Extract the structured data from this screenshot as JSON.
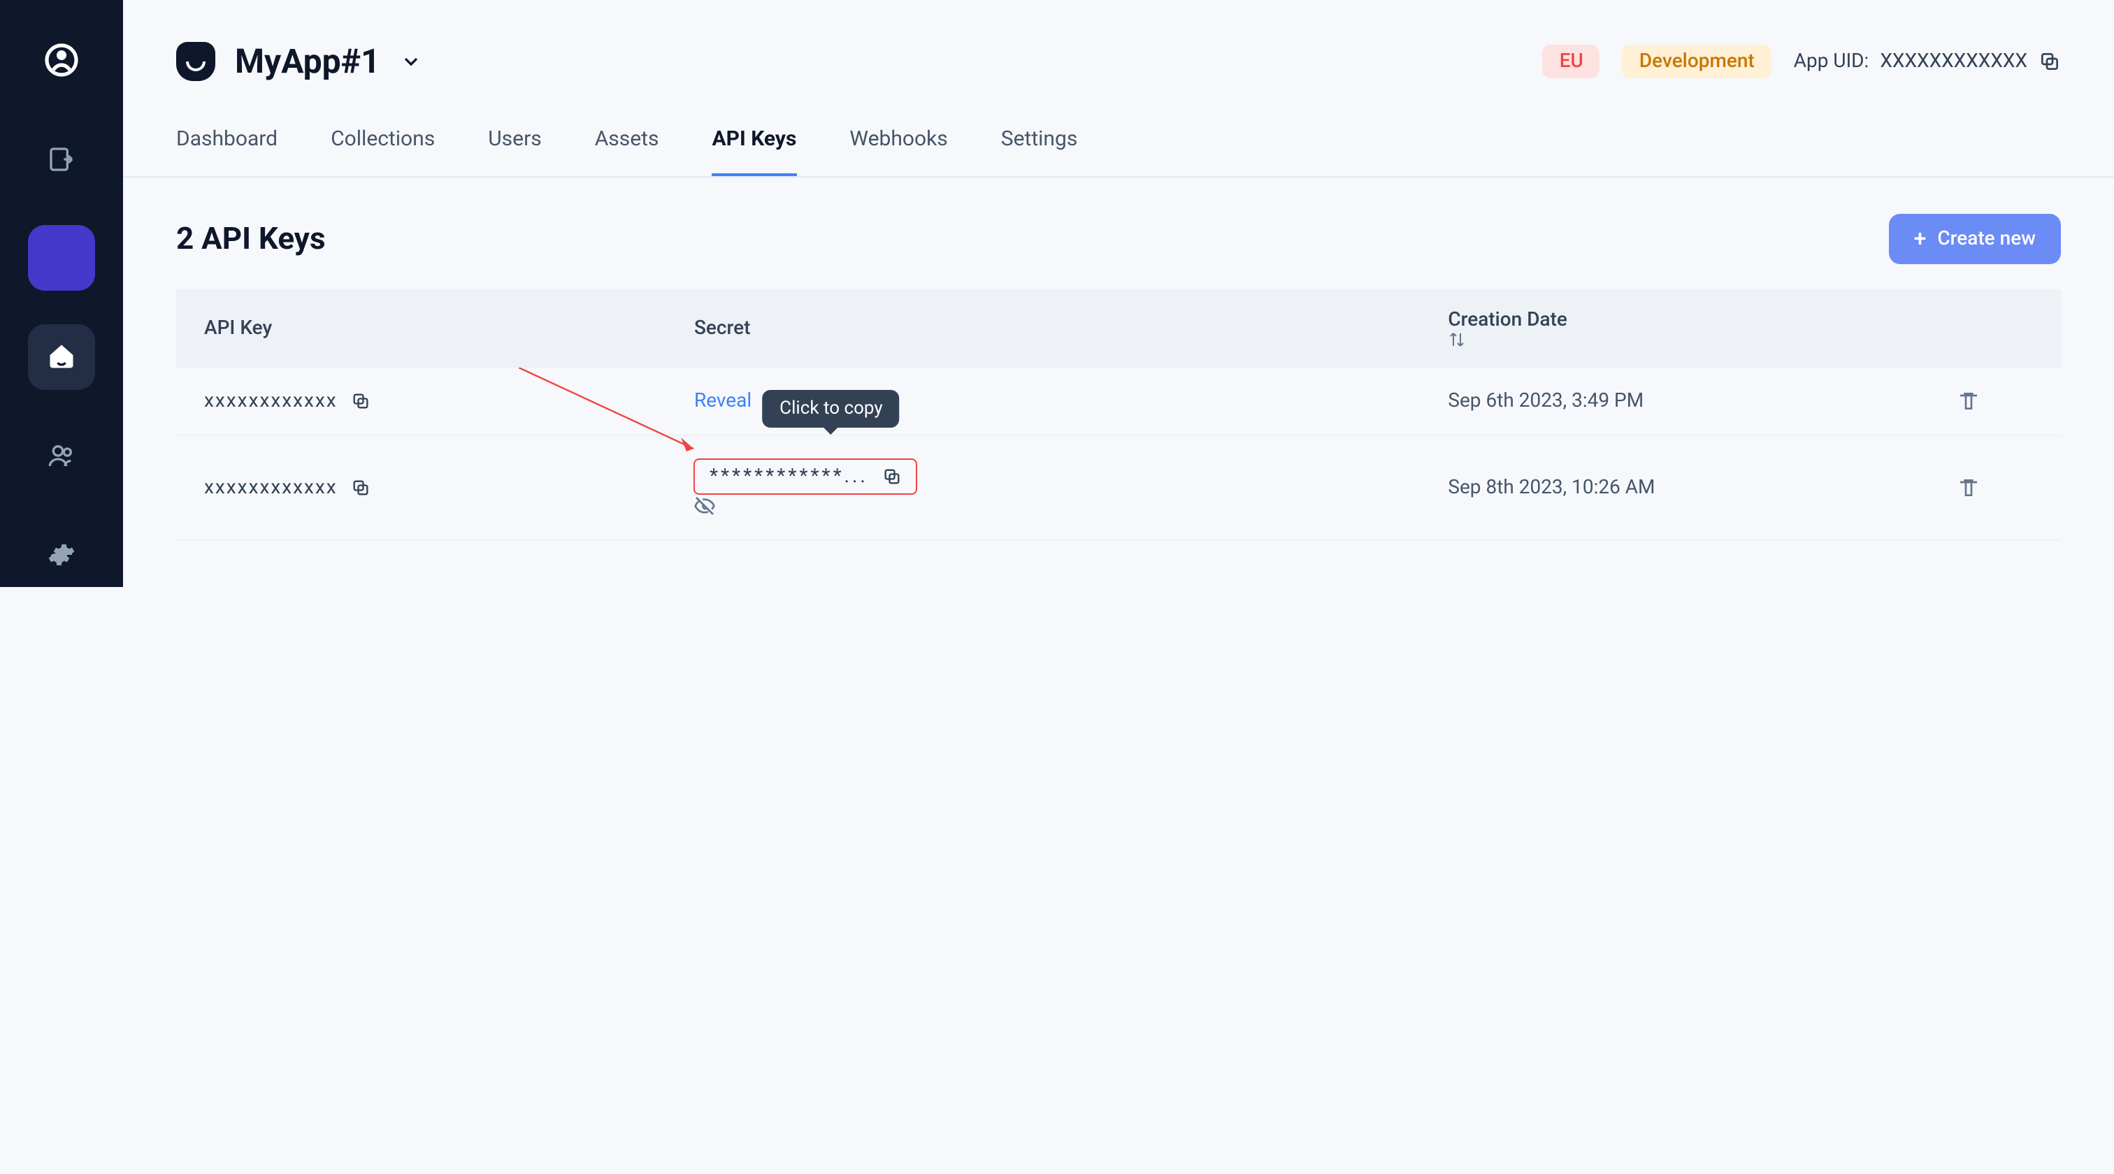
{
  "app": {
    "name": "MyApp#1"
  },
  "topmeta": {
    "region": "EU",
    "env": "Development",
    "uid_label": "App UID:",
    "uid_value": "XXXXXXXXXXXX"
  },
  "tabs": [
    {
      "label": "Dashboard",
      "active": false
    },
    {
      "label": "Collections",
      "active": false
    },
    {
      "label": "Users",
      "active": false
    },
    {
      "label": "Assets",
      "active": false
    },
    {
      "label": "API Keys",
      "active": true
    },
    {
      "label": "Webhooks",
      "active": false
    },
    {
      "label": "Settings",
      "active": false
    }
  ],
  "section": {
    "title": "2 API Keys",
    "create_label": "Create new",
    "table": {
      "headers": {
        "key": "API Key",
        "secret": "Secret",
        "date": "Creation Date"
      },
      "rows": [
        {
          "key": "xxxxxxxxxxxx",
          "secret_mode": "hidden_link",
          "secret_label": "Reveal",
          "date": "Sep 6th 2023, 3:49 PM"
        },
        {
          "key": "xxxxxxxxxxxx",
          "secret_mode": "boxed",
          "secret_value": "************...",
          "date": "Sep 8th 2023, 10:26 AM"
        }
      ]
    },
    "tooltip": "Click to copy"
  },
  "icons": {
    "copy": "copy-icon",
    "sort": "sort-icon",
    "trash": "trash-icon",
    "eye_off": "eye-off-icon",
    "chevron": "chevron-down-icon",
    "plus": "plus-icon"
  }
}
